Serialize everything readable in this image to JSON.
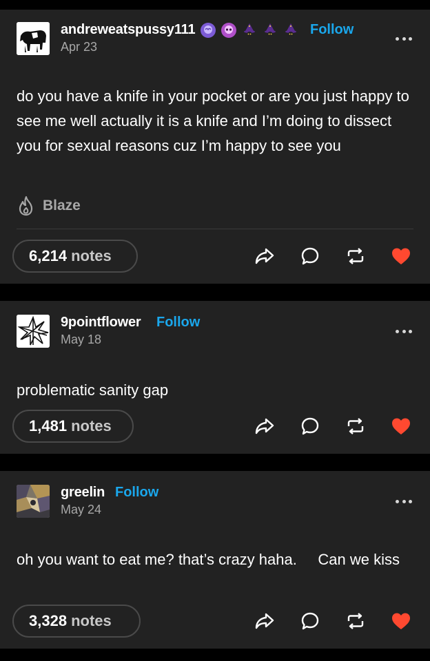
{
  "colors": {
    "page_background": "#000000",
    "card_background": "#222222",
    "follow_link": "#1aa7ec",
    "like_heart": "#ff4930",
    "muted_text": "#a8a8a8"
  },
  "posts": [
    {
      "username": "andreweatspussy111",
      "follow_label": "Follow",
      "date": "Apr 23",
      "badges": [
        "purple-brain-badge",
        "pink-skull-badge",
        "wizard-badge",
        "wizard-badge",
        "wizard-badge"
      ],
      "body": "do you have a knife in your pocket or are you just happy to see me well actually it is a knife and I’m doing to dissect you for sexual reasons cuz I’m happy to see you",
      "community": "Blaze",
      "notes_count": "6,214",
      "notes_label": "notes",
      "avatar_icon": "cow-avatar",
      "liked": true
    },
    {
      "username": "9pointflower",
      "follow_label": "Follow",
      "date": "May 18",
      "body": "problematic sanity gap",
      "notes_count": "1,481",
      "notes_label": "notes",
      "avatar_icon": "nine-point-star-avatar",
      "liked": true
    },
    {
      "username": "greelin",
      "follow_label": "Follow",
      "date": "May 24",
      "body": "oh you want to eat me? that’s crazy haha.     Can we kiss",
      "notes_count": "3,328",
      "notes_label": "notes",
      "avatar_icon": "painting-avatar",
      "liked": true
    }
  ],
  "action_icons": [
    "share-icon",
    "reply-icon",
    "reblog-icon",
    "like-heart-icon"
  ]
}
